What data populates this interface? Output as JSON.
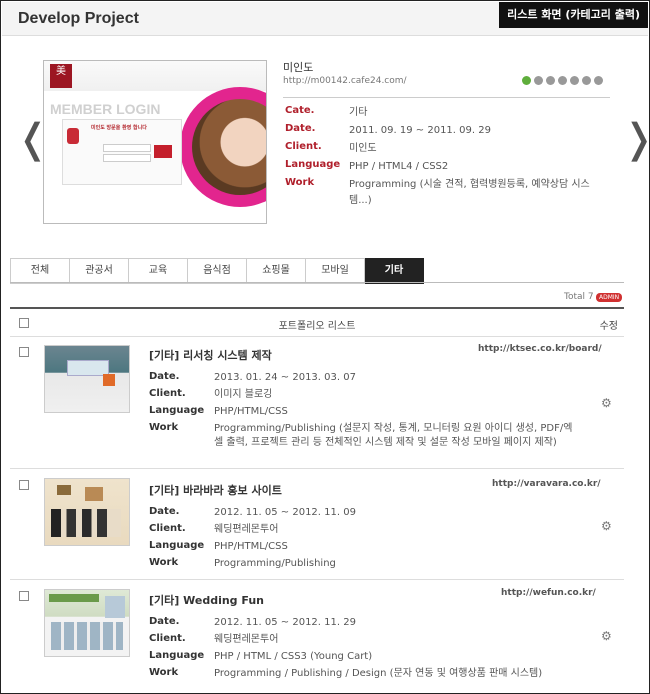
{
  "header": {
    "title": "Develop Project",
    "badge": "리스트 화면 (카테고리 출력)"
  },
  "featured": {
    "prev_icon": "left-angle-icon",
    "next_icon": "right-angle-icon",
    "thumb": {
      "brand": "美",
      "title": "MEMBER LOGIN",
      "message": "미인도 방문을 환영 합니다"
    },
    "name": "미인도",
    "url": "http://m00142.cafe24.com/",
    "fields": [
      {
        "label": "Cate.",
        "value": "기타"
      },
      {
        "label": "Date.",
        "value": "2011. 09. 19 ~ 2011. 09. 29"
      },
      {
        "label": "Client.",
        "value": "미인도"
      },
      {
        "label": "Language",
        "value": "PHP / HTML4 / CSS2"
      },
      {
        "label": "Work",
        "value": "Programming (시술 견적, 협력병원등록, 예약상담 시스템...)"
      }
    ],
    "active_dot": 0,
    "dot_count": 7
  },
  "tabs": [
    "전체",
    "관공서",
    "교육",
    "음식점",
    "쇼핑몰",
    "모바일",
    "기타"
  ],
  "active_tab": 6,
  "total": "Total 7",
  "admin_badge": "ADMIN",
  "list_header": {
    "title": "포트폴리오 리스트",
    "edit": "수정"
  },
  "items": [
    {
      "title": "[기타] 리서칭 시스템 제작",
      "url": "http://ktsec.co.kr/board/",
      "fields": [
        {
          "label": "Date.",
          "value": "2013. 01. 24 ~ 2013. 03. 07"
        },
        {
          "label": "Client.",
          "value": "이미지 블로깅"
        },
        {
          "label": "Language",
          "value": "PHP/HTML/CSS"
        },
        {
          "label": "Work",
          "value": "Programming/Publishing (설문지 작성, 통계, 모니터링 요원 아이디 생성, PDF/엑셀 출력, 프로젝트 관리 등 전체적인 시스템 제작 및 설문 작성 모바일 페이지 제작)"
        }
      ]
    },
    {
      "title": "[기타] 바라바라 홍보 사이트",
      "url": "http://varavara.co.kr/",
      "fields": [
        {
          "label": "Date.",
          "value": "2012. 11. 05 ~ 2012. 11. 09"
        },
        {
          "label": "Client.",
          "value": "웨딩편레몬투어"
        },
        {
          "label": "Language",
          "value": "PHP/HTML/CSS"
        },
        {
          "label": "Work",
          "value": "Programming/Publishing"
        }
      ]
    },
    {
      "title": "[기타] Wedding Fun",
      "url": "http://wefun.co.kr/",
      "fields": [
        {
          "label": "Date.",
          "value": "2012. 11. 05 ~ 2012. 11. 29"
        },
        {
          "label": "Client.",
          "value": "웨딩편레몬투어"
        },
        {
          "label": "Language",
          "value": "PHP / HTML / CSS3 (Young Cart)"
        },
        {
          "label": "Work",
          "value": "Programming / Publishing / Design (문자 연동 및 여행상품 판매 시스템)"
        }
      ]
    }
  ],
  "colors": {
    "label_red": "#b0202c",
    "active_tab": "#222222",
    "dot_active": "#5fae3c"
  }
}
